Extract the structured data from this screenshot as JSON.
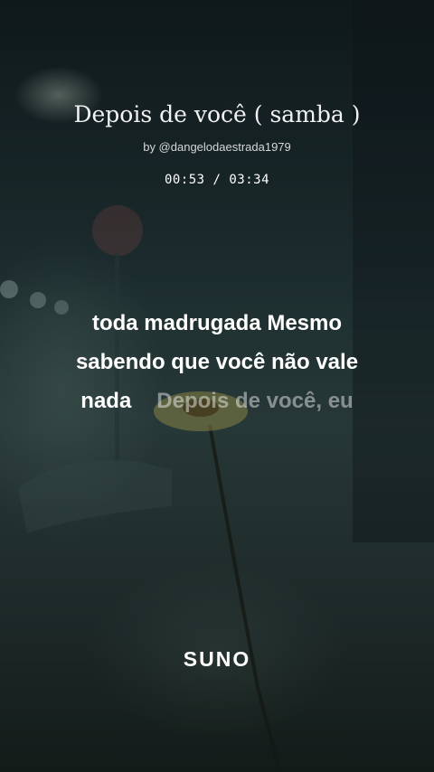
{
  "song": {
    "title": "Depois de você ( samba )",
    "byline": "by @dangelodaestrada1979",
    "time": "00:53 / 03:34"
  },
  "lyrics": {
    "line1": "toda madrugada Mesmo",
    "line2": "sabendo que você não vale",
    "line3_sung": "nada",
    "line3_upcoming": "Depois de você, eu"
  },
  "brand": {
    "logo": "SUNO"
  }
}
